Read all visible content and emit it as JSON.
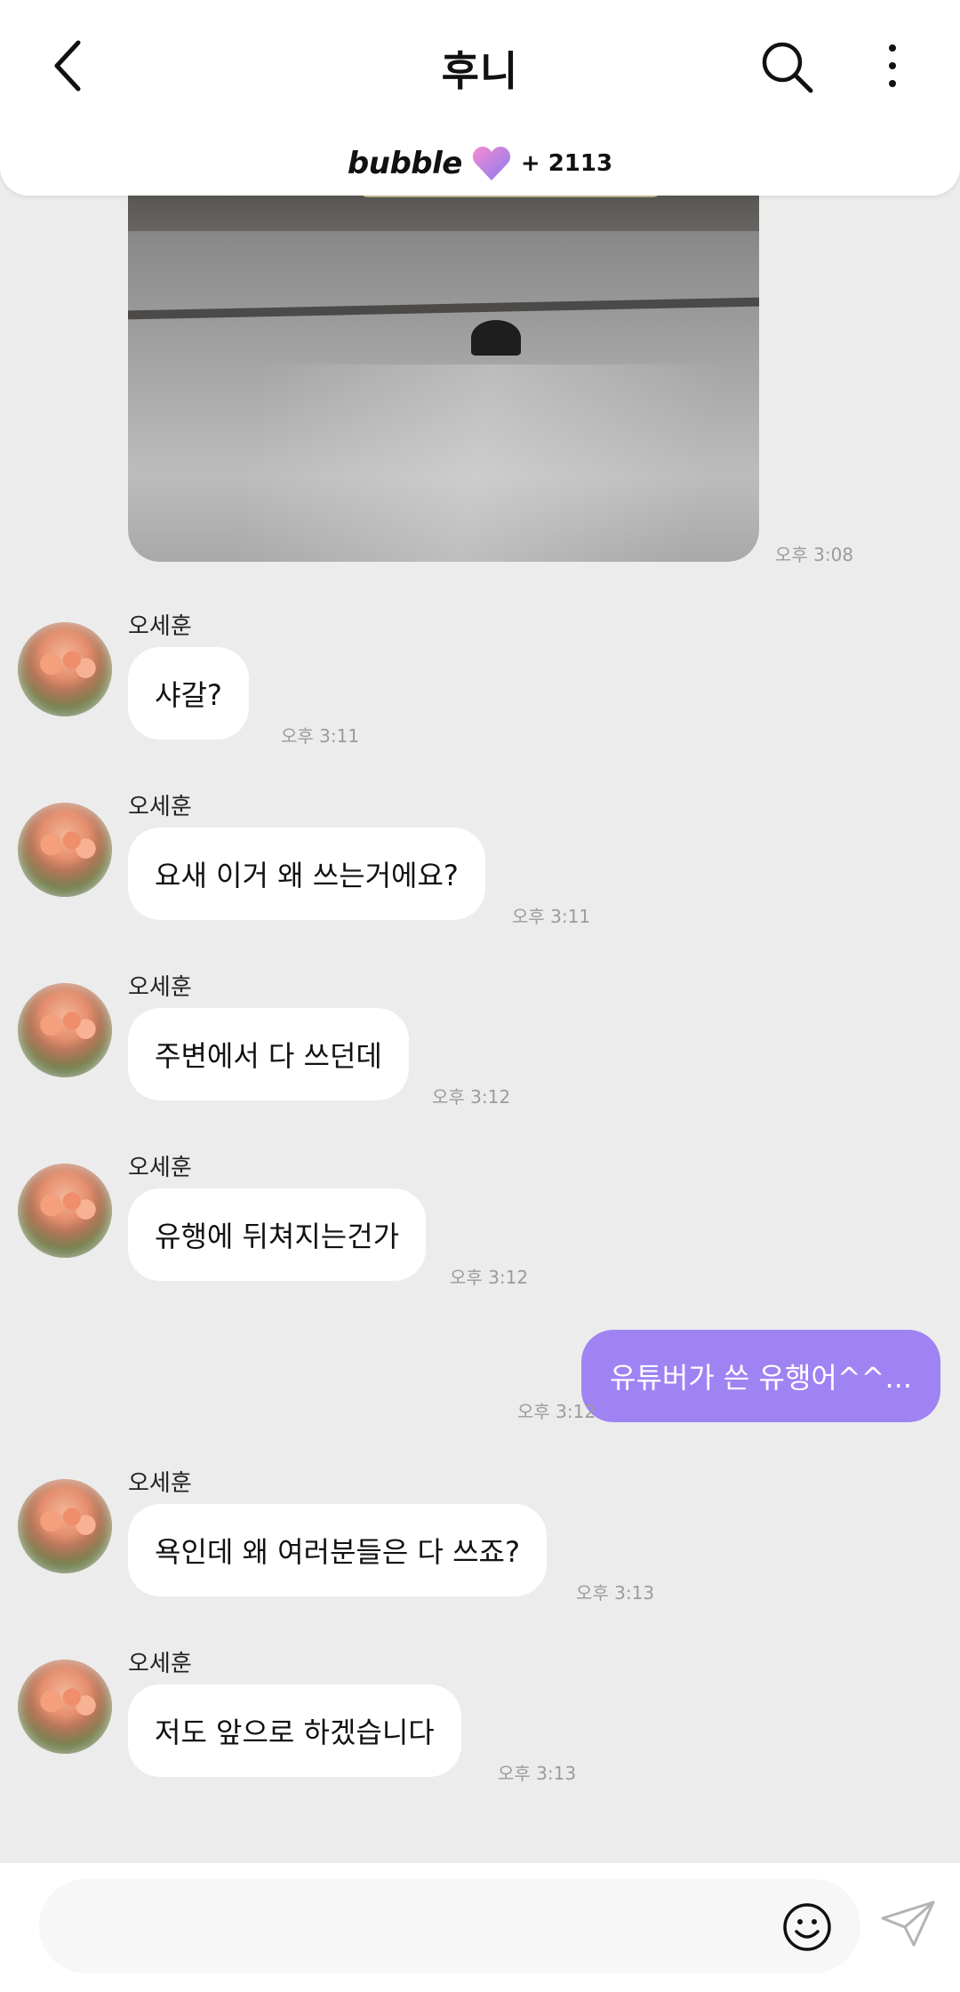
{
  "header": {
    "title": "후니",
    "back_icon": "chevron-left-icon",
    "search_icon": "search-icon",
    "more_icon": "more-vertical-icon",
    "bubble_brand": "bubble",
    "bubble_count": "+ 2113",
    "heart_colors": [
      "#f58bd0",
      "#8a7bf2"
    ]
  },
  "photo_message": {
    "time": "오후 3:08"
  },
  "messages": [
    {
      "sender": "오세훈",
      "text": "샤갈?",
      "time": "오후 3:11"
    },
    {
      "sender": "오세훈",
      "text": "요새 이거 왜 쓰는거에요?",
      "time": "오후 3:11"
    },
    {
      "sender": "오세훈",
      "text": "주변에서 다 쓰던데",
      "time": "오후 3:12"
    },
    {
      "sender": "오세훈",
      "text": "유행에 뒤쳐지는건가",
      "time": "오후 3:12"
    },
    {
      "sender": "오세훈",
      "text": "욕인데 왜 여러분들은 다 쓰죠?",
      "time": "오후 3:13"
    },
    {
      "sender": "오세훈",
      "text": "저도 앞으로 하겠습니다",
      "time": "오후 3:13"
    }
  ],
  "outgoing": {
    "text": "유튜버가 쓴 유행어^^...",
    "time": "오후 3:12",
    "color": "#9f83f3"
  },
  "composer": {
    "placeholder": "",
    "emoji_icon": "smiley-icon",
    "send_icon": "paper-plane-icon"
  }
}
